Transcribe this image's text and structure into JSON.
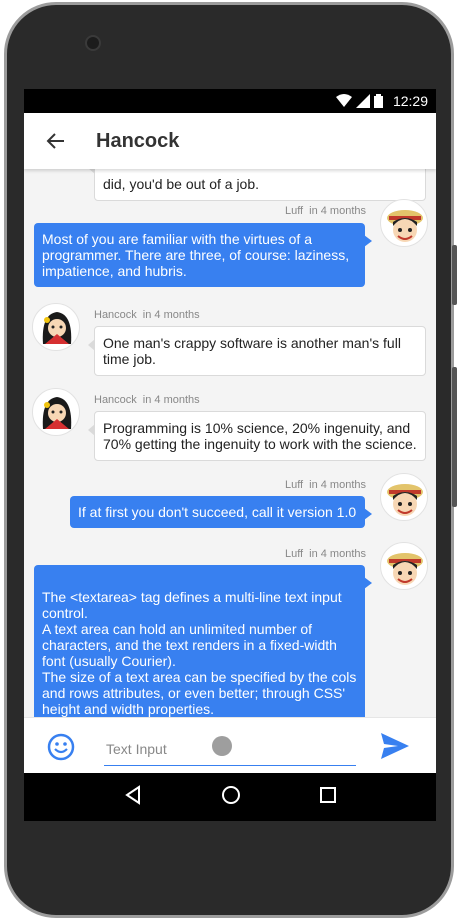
{
  "status_bar": {
    "time": "12:29"
  },
  "header": {
    "title": "Hancock"
  },
  "messages": [
    {
      "direction": "in",
      "sender": "",
      "when": "",
      "text": "did, you'd be out of a job."
    },
    {
      "direction": "out",
      "sender": "Luff",
      "when": "in 4 months",
      "text": "Most of you are familiar with the virtues of a programmer. There are three, of course: laziness, impatience, and hubris."
    },
    {
      "direction": "in",
      "sender": "Hancock",
      "when": "in 4 months",
      "text": "One man's crappy software is another man's full time job."
    },
    {
      "direction": "in",
      "sender": "Hancock",
      "when": "in 4 months",
      "text": "Programming is 10% science, 20% ingenuity, and 70% getting the ingenuity to work with the science."
    },
    {
      "direction": "out",
      "sender": "Luff",
      "when": "in 4 months",
      "text": "If at first you don't succeed, call it version 1.0"
    },
    {
      "direction": "out",
      "sender": "Luff",
      "when": "in 4 months",
      "text": "The <textarea> tag defines a multi-line text input control.\nA text area can hold an unlimited number of characters, and the text renders in a fixed-width font (usually Courier).\nThe size of a text area can be specified by the cols and rows attributes, or even better; through CSS' height and width properties."
    }
  ],
  "composer": {
    "placeholder": "Text Input",
    "value": ""
  },
  "colors": {
    "accent": "#3880f0",
    "bubble_in": "#ffffff",
    "background": "#f4f4f4"
  },
  "icons": {
    "back": "arrow-back-icon",
    "emoji": "emoji-icon",
    "send": "send-icon",
    "nav_back": "triangle-back-icon",
    "nav_home": "circle-home-icon",
    "nav_recent": "square-recent-icon"
  }
}
